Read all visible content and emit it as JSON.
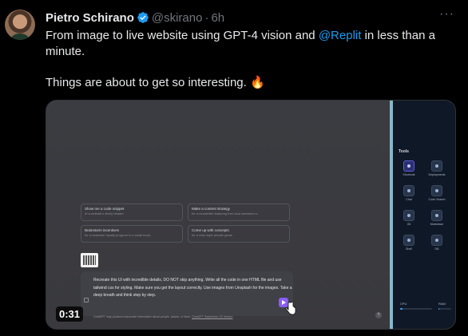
{
  "tweet": {
    "author": {
      "display_name": "Pietro Schirano",
      "handle": "@skirano",
      "separator": "·",
      "time": "6h"
    },
    "text_line1_a": "From image to live website using GPT-4 vision and ",
    "mention": "@Replit",
    "text_line1_b": "  in less than a",
    "text_line2": "minute.",
    "text_line3": "Things are about to get so interesting. 🔥",
    "more_label": "···"
  },
  "video": {
    "duration": "0:31",
    "suggestions": [
      {
        "title": "Show me a code snippet",
        "sub": "of a website's sticky header"
      },
      {
        "title": "Make a content strategy",
        "sub": "for a newsletter featuring free local weekend e..."
      },
      {
        "title": "Brainstorm incentives",
        "sub": "for a customer loyalty program in a small book..."
      },
      {
        "title": "Come up with concepts",
        "sub": "for a retro style arcade game"
      }
    ],
    "prompt": "Recreate this UI with incredible details, DO NOT skip anything. Write all the code in one HTML file and use tailwind css for styling. Make sure you get the layout correctly. Use images from Unsplash for the images. Take a deep breath and think step by step.",
    "disclaimer": "ChatGPT may produce inaccurate information about people, places, or facts.",
    "disclaimer_link": "ChatGPT September 25 Version",
    "help": "?",
    "tools_title": "Tools",
    "tools": [
      {
        "label": "Shortcuts"
      },
      {
        "label": "Deployments"
      },
      {
        "label": "Chat"
      },
      {
        "label": "Code Search"
      },
      {
        "label": "Git"
      },
      {
        "label": "Markdown"
      },
      {
        "label": "Shell"
      },
      {
        "label": "DB"
      }
    ],
    "stats": {
      "cpu_label": "CPU",
      "ram_label": "RAM",
      "cpu_fraction": 0.08,
      "ram_fraction": 0.05
    },
    "accent_color": "#8b5cf6"
  },
  "colors": {
    "background": "#000000",
    "text": "#e7e9ea",
    "muted": "#71767b",
    "link": "#1d9bf0",
    "verified": "#1d9bf0"
  },
  "icons": {
    "verified": "verified-badge-icon",
    "more": "more-horizontal-icon",
    "send": "send-icon",
    "cursor": "hand-cursor-icon"
  }
}
